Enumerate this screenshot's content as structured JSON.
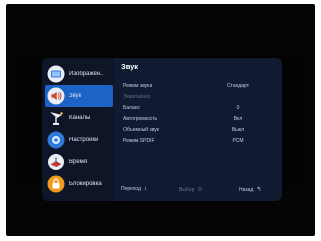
{
  "sidebar": {
    "items": [
      {
        "label": "Изображен..",
        "icon": "picture-icon",
        "active": false
      },
      {
        "label": "Звук",
        "icon": "sound-icon",
        "active": true
      },
      {
        "label": "Каналы",
        "icon": "antenna-icon",
        "active": false
      },
      {
        "label": "Настройки",
        "icon": "settings-icon",
        "active": false
      },
      {
        "label": "Время",
        "icon": "clock-icon",
        "active": false
      },
      {
        "label": "Блокировка",
        "icon": "lock-icon",
        "active": false
      }
    ]
  },
  "content": {
    "title": "Звук",
    "rows": [
      {
        "label": "Режим звука",
        "value": "Стандарт",
        "disabled": false
      },
      {
        "label": "Эквалайзер",
        "value": "",
        "disabled": true
      },
      {
        "label": "Баланс",
        "value": "0",
        "disabled": false
      },
      {
        "label": "Автогромкость",
        "value": "Вкл",
        "disabled": false
      },
      {
        "label": "Объемный звук",
        "value": "Выкл",
        "disabled": false
      },
      {
        "label": "Режим SPDIF",
        "value": "PCM",
        "disabled": false
      }
    ]
  },
  "footer": {
    "navigate_label": "Переход",
    "navigate_symbol": "↕",
    "select_label": "Выбор",
    "select_symbol": "⊙",
    "back_label": "Назад",
    "back_symbol": "↰"
  },
  "colors": {
    "accent": "#1d63c6",
    "panel": "#101a30",
    "sidebar": "#0e1526"
  }
}
